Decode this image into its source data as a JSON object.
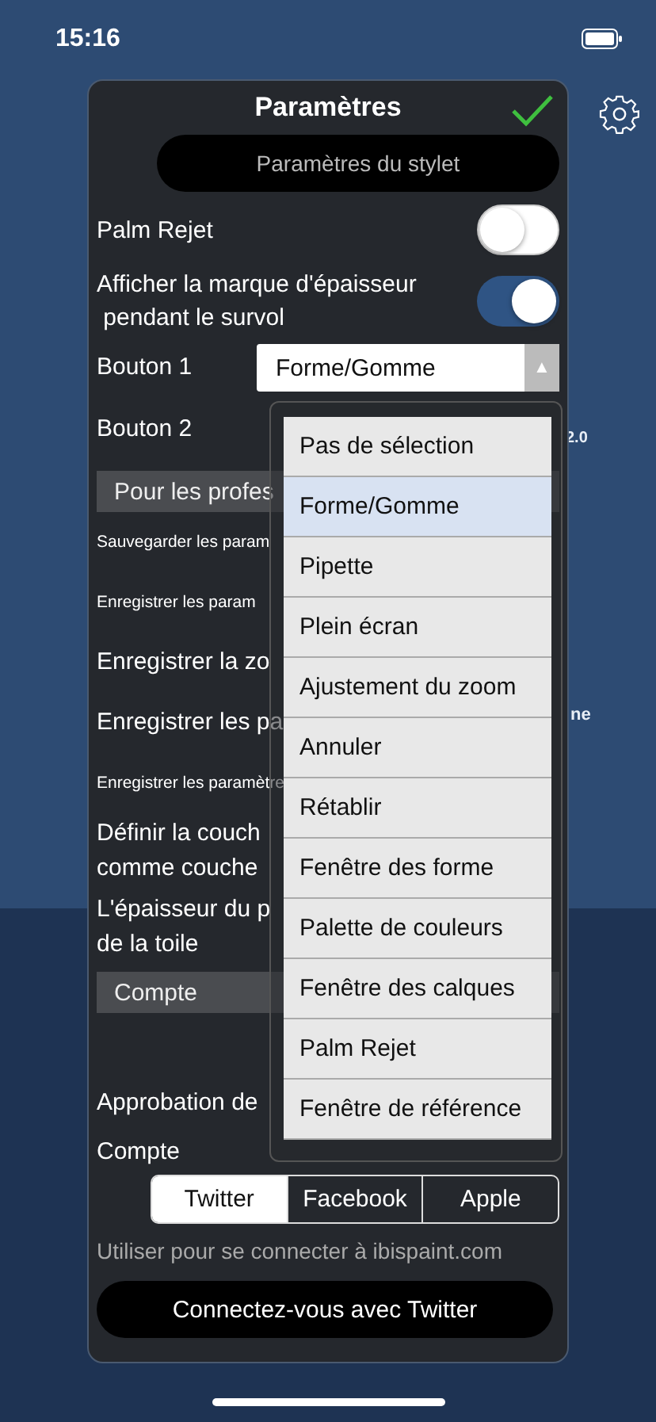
{
  "status_bar": {
    "time": "15:16"
  },
  "background_texts": [
    "2.0",
    "ne"
  ],
  "dialog": {
    "title": "Paramètres",
    "stylus_button": "Paramètres du stylet",
    "toggles": [
      {
        "label_lines": [
          "Palm Rejet"
        ],
        "on": false
      },
      {
        "label_lines": [
          "Afficher la marque d'épaisseur",
          " pendant le survol"
        ],
        "on": true
      }
    ],
    "selects": [
      {
        "label": "Bouton 1",
        "value": "Forme/Gomme",
        "arrow": "▲"
      },
      {
        "label": "Bouton 2"
      }
    ],
    "pro_section": {
      "header": "Pour les profes",
      "rows": [
        {
          "kind": "small",
          "lines": [
            "Sauvegarder les param"
          ]
        },
        {
          "kind": "small",
          "lines": [
            "Enregistrer les param"
          ]
        },
        {
          "kind": "large",
          "lines": [
            "Enregistrer la zo"
          ]
        },
        {
          "kind": "large",
          "lines": [
            "Enregistrer les pa"
          ]
        },
        {
          "kind": "small",
          "lines": [
            "Enregistrer les paramètre"
          ]
        },
        {
          "kind": "large",
          "lines": [
            "Définir la couch",
            "comme couche"
          ]
        },
        {
          "kind": "large",
          "lines": [
            "L'épaisseur du p",
            "de la toile"
          ]
        }
      ]
    },
    "account_section": {
      "header": "Compte",
      "approval": "Approbation de",
      "account_label": "Compte",
      "options": [
        {
          "label": "Twitter",
          "selected": true
        },
        {
          "label": "Facebook",
          "selected": false
        },
        {
          "label": "Apple",
          "selected": false
        }
      ],
      "note": "Utiliser pour se connecter à ibispaint.com",
      "login_button": "Connectez-vous avec Twitter"
    },
    "dropdown": {
      "options": [
        {
          "label": "Pas de sélection",
          "selected": false
        },
        {
          "label": "Forme/Gomme",
          "selected": true
        },
        {
          "label": "Pipette",
          "selected": false
        },
        {
          "label": "Plein écran",
          "selected": false
        },
        {
          "label": "Ajustement du zoom",
          "selected": false
        },
        {
          "label": "Annuler",
          "selected": false
        },
        {
          "label": "Rétablir",
          "selected": false
        },
        {
          "label": "Fenêtre des forme",
          "selected": false
        },
        {
          "label": "Palette de couleurs",
          "selected": false
        },
        {
          "label": "Fenêtre des calques",
          "selected": false
        },
        {
          "label": "Palm Rejet",
          "selected": false
        },
        {
          "label": "Fenêtre de référence",
          "selected": false
        }
      ]
    }
  }
}
